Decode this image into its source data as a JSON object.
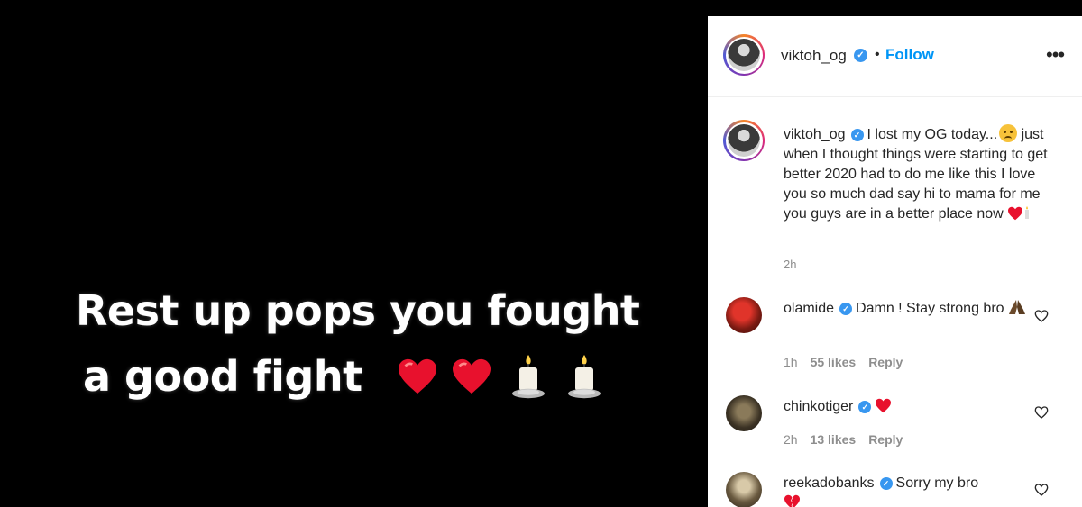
{
  "story": {
    "line1": "Rest up pops you fought",
    "line2": "a good fight"
  },
  "post": {
    "username": "viktoh_og",
    "follow_label": "Follow",
    "dot": "•",
    "more": "•••",
    "caption": {
      "username": "viktoh_og",
      "text_start": "I lost my OG today...",
      "text_rest": "just when I thought things were starting to get better 2020 had to do me like this I love you so much dad say hi to mama for me you guys are in a better place now",
      "time": "2h"
    }
  },
  "comments": [
    {
      "username": "olamide",
      "text": "Damn ! Stay strong bro",
      "time": "1h",
      "likes": "55 likes",
      "reply": "Reply"
    },
    {
      "username": "chinkotiger",
      "text": "",
      "time": "2h",
      "likes": "13 likes",
      "reply": "Reply"
    },
    {
      "username": "reekadobanks",
      "text": "Sorry my bro"
    }
  ],
  "colors": {
    "follow": "#0095f6",
    "verified": "#3897f0",
    "text": "#262626",
    "muted": "#8e8e8e"
  },
  "icons": {
    "verified": "check",
    "more": "more-horizontal-icon",
    "like": "heart-outline-icon"
  }
}
